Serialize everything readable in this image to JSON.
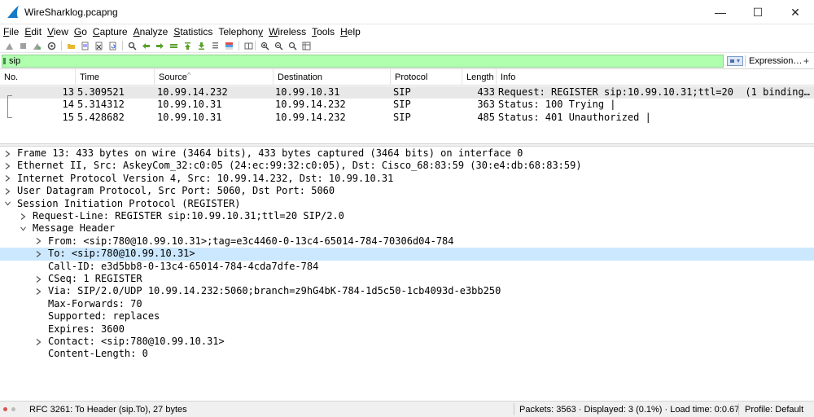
{
  "window": {
    "title": "WireSharklog.pcapng",
    "minimize_glyph": "—",
    "maximize_glyph": "☐",
    "close_glyph": "✕",
    "icon": "wireshark-fin-icon",
    "icon_color": "#1679c6"
  },
  "menu": [
    {
      "pre": "",
      "ul": "F",
      "post": "ile"
    },
    {
      "pre": "",
      "ul": "E",
      "post": "dit"
    },
    {
      "pre": "",
      "ul": "V",
      "post": "iew"
    },
    {
      "pre": "",
      "ul": "G",
      "post": "o"
    },
    {
      "pre": "",
      "ul": "C",
      "post": "apture"
    },
    {
      "pre": "",
      "ul": "A",
      "post": "nalyze"
    },
    {
      "pre": "",
      "ul": "S",
      "post": "tatistics"
    },
    {
      "pre": "Telephon",
      "ul": "y",
      "post": ""
    },
    {
      "pre": "",
      "ul": "W",
      "post": "ireless"
    },
    {
      "pre": "",
      "ul": "T",
      "post": "ools"
    },
    {
      "pre": "",
      "ul": "H",
      "post": "elp"
    }
  ],
  "filter": {
    "value": "sip",
    "expression_label": "Expression…",
    "add_label": "+",
    "color": "#afffaf"
  },
  "packet_list": {
    "columns": [
      "No.",
      "Time",
      "Source",
      "Destination",
      "Protocol",
      "Length",
      "Info"
    ],
    "sort_indicator": "^",
    "rows": [
      {
        "no": "13",
        "time": "5.309521",
        "source": "10.99.14.232",
        "destination": "10.99.10.31",
        "protocol": "SIP",
        "length": "433",
        "info": "Request: REGISTER sip:10.99.10.31;ttl=20  (1 binding) …"
      },
      {
        "no": "14",
        "time": "5.314312",
        "source": "10.99.10.31",
        "destination": "10.99.14.232",
        "protocol": "SIP",
        "length": "363",
        "info": "Status: 100 Trying |"
      },
      {
        "no": "15",
        "time": "5.428682",
        "source": "10.99.10.31",
        "destination": "10.99.14.232",
        "protocol": "SIP",
        "length": "485",
        "info": "Status: 401 Unauthorized |"
      }
    ]
  },
  "details": [
    {
      "text": "Frame 13: 433 bytes on wire (3464 bits), 433 bytes captured (3464 bits) on interface 0",
      "level": 0,
      "arrow": "right"
    },
    {
      "text": "Ethernet II, Src: AskeyCom_32:c0:05 (24:ec:99:32:c0:05), Dst: Cisco_68:83:59 (30:e4:db:68:83:59)",
      "level": 0,
      "arrow": "right"
    },
    {
      "text": "Internet Protocol Version 4, Src: 10.99.14.232, Dst: 10.99.10.31",
      "level": 0,
      "arrow": "right"
    },
    {
      "text": "User Datagram Protocol, Src Port: 5060, Dst Port: 5060",
      "level": 0,
      "arrow": "right"
    },
    {
      "text": "Session Initiation Protocol (REGISTER)",
      "level": 0,
      "arrow": "down"
    },
    {
      "text": "Request-Line: REGISTER sip:10.99.10.31;ttl=20 SIP/2.0",
      "level": 1,
      "arrow": "right"
    },
    {
      "text": "Message Header",
      "level": 1,
      "arrow": "down"
    },
    {
      "text": "From: <sip:780@10.99.10.31>;tag=e3c4460-0-13c4-65014-784-70306d04-784",
      "level": 2,
      "arrow": "right"
    },
    {
      "text": "To: <sip:780@10.99.10.31>",
      "level": 2,
      "arrow": "right",
      "selected": true
    },
    {
      "text": "Call-ID: e3d5bb8-0-13c4-65014-784-4cda7dfe-784",
      "level": 2,
      "arrow": "none"
    },
    {
      "text": "CSeq: 1 REGISTER",
      "level": 2,
      "arrow": "right"
    },
    {
      "text": "Via: SIP/2.0/UDP 10.99.14.232:5060;branch=z9hG4bK-784-1d5c50-1cb4093d-e3bb250",
      "level": 2,
      "arrow": "right"
    },
    {
      "text": "Max-Forwards: 70",
      "level": 2,
      "arrow": "none"
    },
    {
      "text": "Supported: replaces",
      "level": 2,
      "arrow": "none"
    },
    {
      "text": "Expires: 3600",
      "level": 2,
      "arrow": "none"
    },
    {
      "text": "Contact: <sip:780@10.99.10.31>",
      "level": 2,
      "arrow": "right"
    },
    {
      "text": "Content-Length: 0",
      "level": 2,
      "arrow": "none"
    }
  ],
  "status": {
    "field_info": "RFC 3261: To Header (sip.To), 27 bytes",
    "packets": "Packets: 3563 · Displayed: 3 (0.1%) · Load time: 0:0.67",
    "profile": "Profile: Default",
    "led_error_color": "#d9534f",
    "led_info_color": "#bbbbbb"
  },
  "colors": {
    "selected_packet_row": "#e8e8e8",
    "selected_tree_row": "#cce8ff"
  }
}
